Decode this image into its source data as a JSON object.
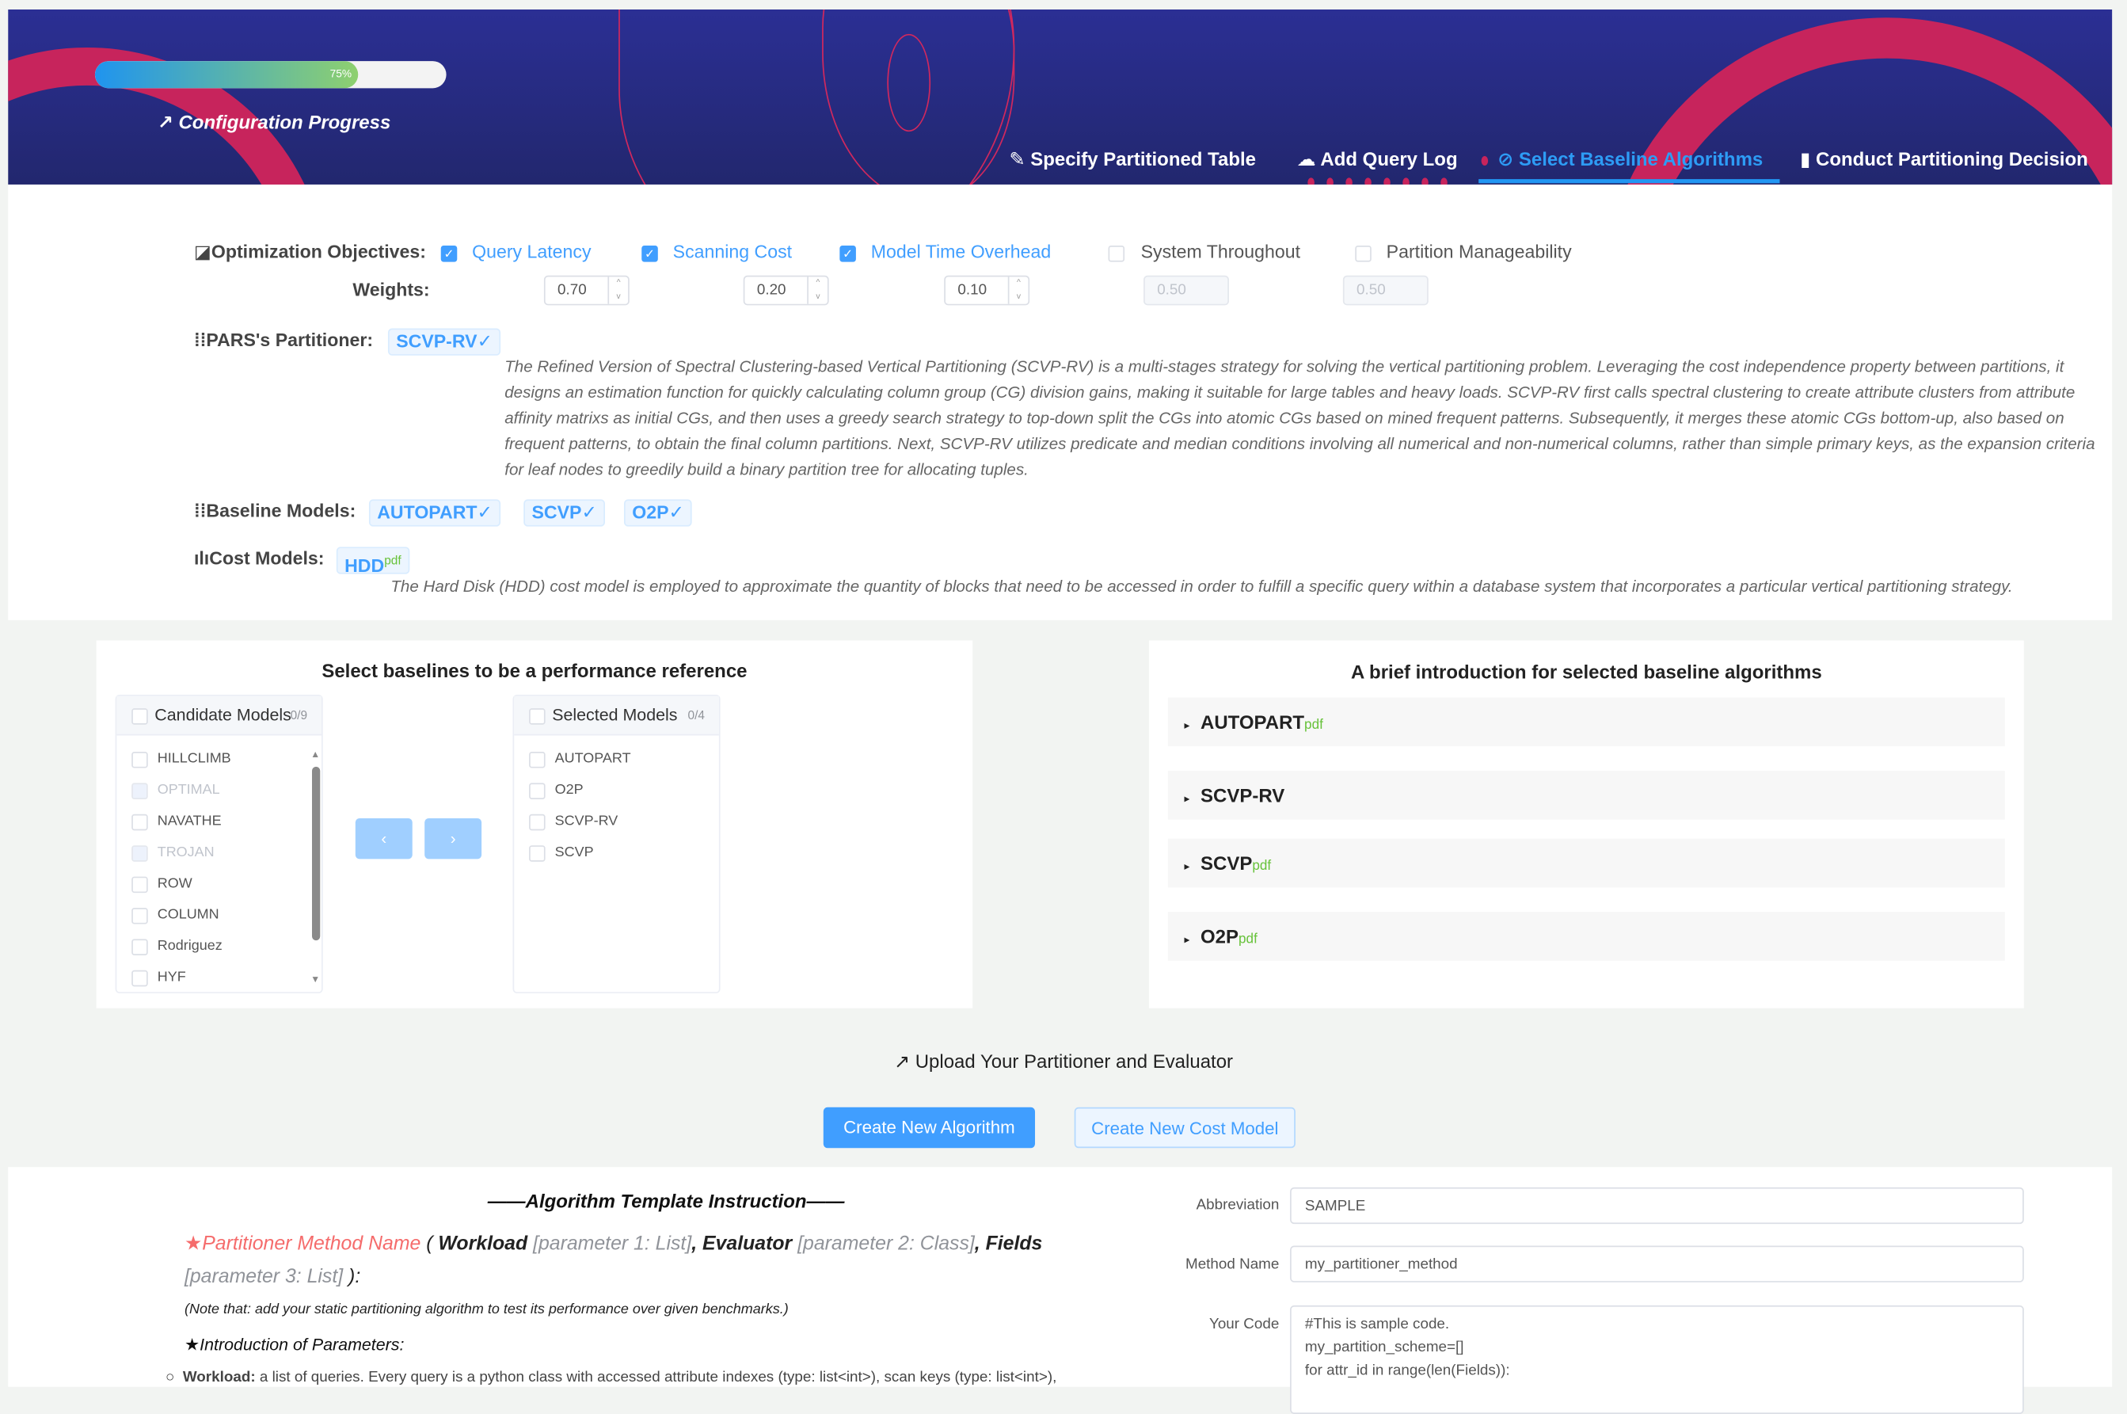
{
  "header": {
    "progress_percent": 75,
    "progress_label": "75%",
    "title": "Configuration Progress",
    "tabs": [
      {
        "label": "Specify Partitioned Table",
        "icon": "pencil-icon",
        "active": false
      },
      {
        "label": "Add Query Log",
        "icon": "cloud-upload-icon",
        "active": false
      },
      {
        "label": "Select Baseline Algorithms",
        "icon": "link-icon",
        "active": true
      },
      {
        "label": "Conduct Partitioning Decision",
        "icon": "bar-chart-icon",
        "active": false
      }
    ],
    "colors": {
      "background": "#2b2f94",
      "accent": "#c7245c",
      "active_tab": "#2196f3"
    }
  },
  "config": {
    "objectives_label": "Optimization Objectives:",
    "objectives": [
      {
        "label": "Query Latency",
        "checked": true,
        "weight": "0.70"
      },
      {
        "label": "Scanning Cost",
        "checked": true,
        "weight": "0.20"
      },
      {
        "label": "Model Time Overhead",
        "checked": true,
        "weight": "0.10"
      },
      {
        "label": "System Throughout",
        "checked": false,
        "weight": "0.50"
      },
      {
        "label": "Partition Manageability",
        "checked": false,
        "weight": "0.50"
      }
    ],
    "weights_label": "Weights:",
    "partitioner_label": "PARS's Partitioner:",
    "partitioner_tag": "SCVP-RV✓",
    "partitioner_desc": "The Refined Version of Spectral Clustering-based Vertical Partitioning (SCVP-RV) is a multi-stages strategy for solving the vertical partitioning problem. Leveraging the cost independence property between partitions, it designs an estimation function for quickly calculating column group (CG) division gains, making it suitable for large tables and heavy loads. SCVP-RV first calls spectral clustering to create attribute clusters from attribute affinity matrixs as initial CGs, and then uses a greedy search strategy to top-down split the CGs into atomic CGs based on mined frequent patterns. Subsequently, it merges these atomic CGs bottom-up, also based on frequent patterns, to obtain the final column partitions. Next, SCVP-RV utilizes predicate and median conditions involving all numerical and non-numerical columns, rather than simple primary keys, as the expansion criteria for leaf nodes to greedily build a binary partition tree for allocating tuples.",
    "baseline_label": "Baseline Models:",
    "baseline_tags": [
      "AUTOPART✓",
      "SCVP✓",
      "O2P✓"
    ],
    "cost_label": "Cost Models:",
    "cost_tag": "HDD",
    "cost_tag_sup": "pdf",
    "cost_desc": "The Hard Disk (HDD) cost model is employed to approximate the quantity of blocks that need to be accessed in order to fulfill a specific query within a database system that incorporates a particular vertical partitioning strategy."
  },
  "transfer": {
    "title": "Select baselines to be a performance reference",
    "left_title": "Candidate Models",
    "left_count": "0/9",
    "left_items": [
      {
        "label": "HILLCLIMB",
        "disabled": false
      },
      {
        "label": "OPTIMAL",
        "disabled": true
      },
      {
        "label": "NAVATHE",
        "disabled": false
      },
      {
        "label": "TROJAN",
        "disabled": true
      },
      {
        "label": "ROW",
        "disabled": false
      },
      {
        "label": "COLUMN",
        "disabled": false
      },
      {
        "label": "Rodriguez",
        "disabled": false
      },
      {
        "label": "HYF",
        "disabled": false
      }
    ],
    "right_title": "Selected Models",
    "right_count": "0/4",
    "right_items": [
      "AUTOPART",
      "O2P",
      "SCVP-RV",
      "SCVP"
    ],
    "btn_left": "‹",
    "btn_right": "›"
  },
  "intro": {
    "title": "A brief introduction for selected baseline algorithms",
    "items": [
      {
        "label": "AUTOPART",
        "sup": "pdf"
      },
      {
        "label": "SCVP-RV",
        "sup": ""
      },
      {
        "label": "SCVP",
        "sup": "pdf"
      },
      {
        "label": "O2P",
        "sup": "pdf"
      }
    ]
  },
  "upload": {
    "title": "Upload Your Partitioner and Evaluator",
    "create_algorithm": "Create New Algorithm",
    "create_cost_model": "Create New Cost Model"
  },
  "template": {
    "title": "——Algorithm Template Instruction——",
    "method_name": "Partitioner Method Name",
    "sig_open": " ( ",
    "p1_name": "Workload",
    "p1_type": " [parameter 1: List]",
    "p2_name": ", Evaluator",
    "p2_type": " [parameter 2: Class]",
    "p3_name": ", Fields",
    "p3_type": "[parameter 3: List]",
    "sig_close": " ):",
    "note": "(Note that: add your static partitioning algorithm to test its performance over given benchmarks.)",
    "params_heading": "Introduction of Parameters:",
    "workload_label": "Workload:",
    "workload_desc": " a list of queries. Every query is a python class with accessed attribute indexes (type: list<int>), scan keys (type: list<int>),"
  },
  "form": {
    "abbreviation_label": "Abbreviation",
    "abbreviation_value": "SAMPLE",
    "method_label": "Method Name",
    "method_value": "my_partitioner_method",
    "code_label": "Your Code",
    "code_lines": [
      "#This is sample code.",
      "my_partition_scheme=[]",
      "for attr_id in range(len(Fields)):"
    ]
  }
}
